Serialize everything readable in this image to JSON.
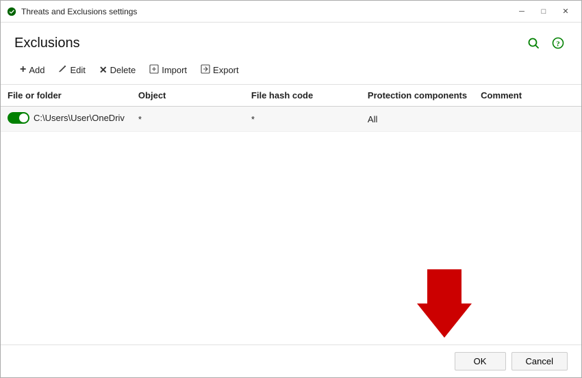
{
  "window": {
    "title": "Threats and Exclusions settings",
    "controls": {
      "minimize": "─",
      "maximize": "□",
      "close": "✕"
    }
  },
  "header": {
    "title": "Exclusions",
    "search_icon": "search",
    "help_icon": "help"
  },
  "toolbar": {
    "add_label": "Add",
    "edit_label": "Edit",
    "delete_label": "Delete",
    "import_label": "Import",
    "export_label": "Export"
  },
  "table": {
    "columns": [
      {
        "key": "file_folder",
        "label": "File or folder"
      },
      {
        "key": "object",
        "label": "Object"
      },
      {
        "key": "file_hash_code",
        "label": "File hash code"
      },
      {
        "key": "protection_components",
        "label": "Protection components"
      },
      {
        "key": "comment",
        "label": "Comment"
      }
    ],
    "rows": [
      {
        "enabled": true,
        "file_folder": "C:\\Users\\User\\OneDriv",
        "object": "*",
        "file_hash_code": "*",
        "protection_components": "All",
        "comment": ""
      }
    ]
  },
  "buttons": {
    "ok_label": "OK",
    "cancel_label": "Cancel"
  },
  "colors": {
    "green": "#008000",
    "arrow_red": "#cc0000"
  }
}
